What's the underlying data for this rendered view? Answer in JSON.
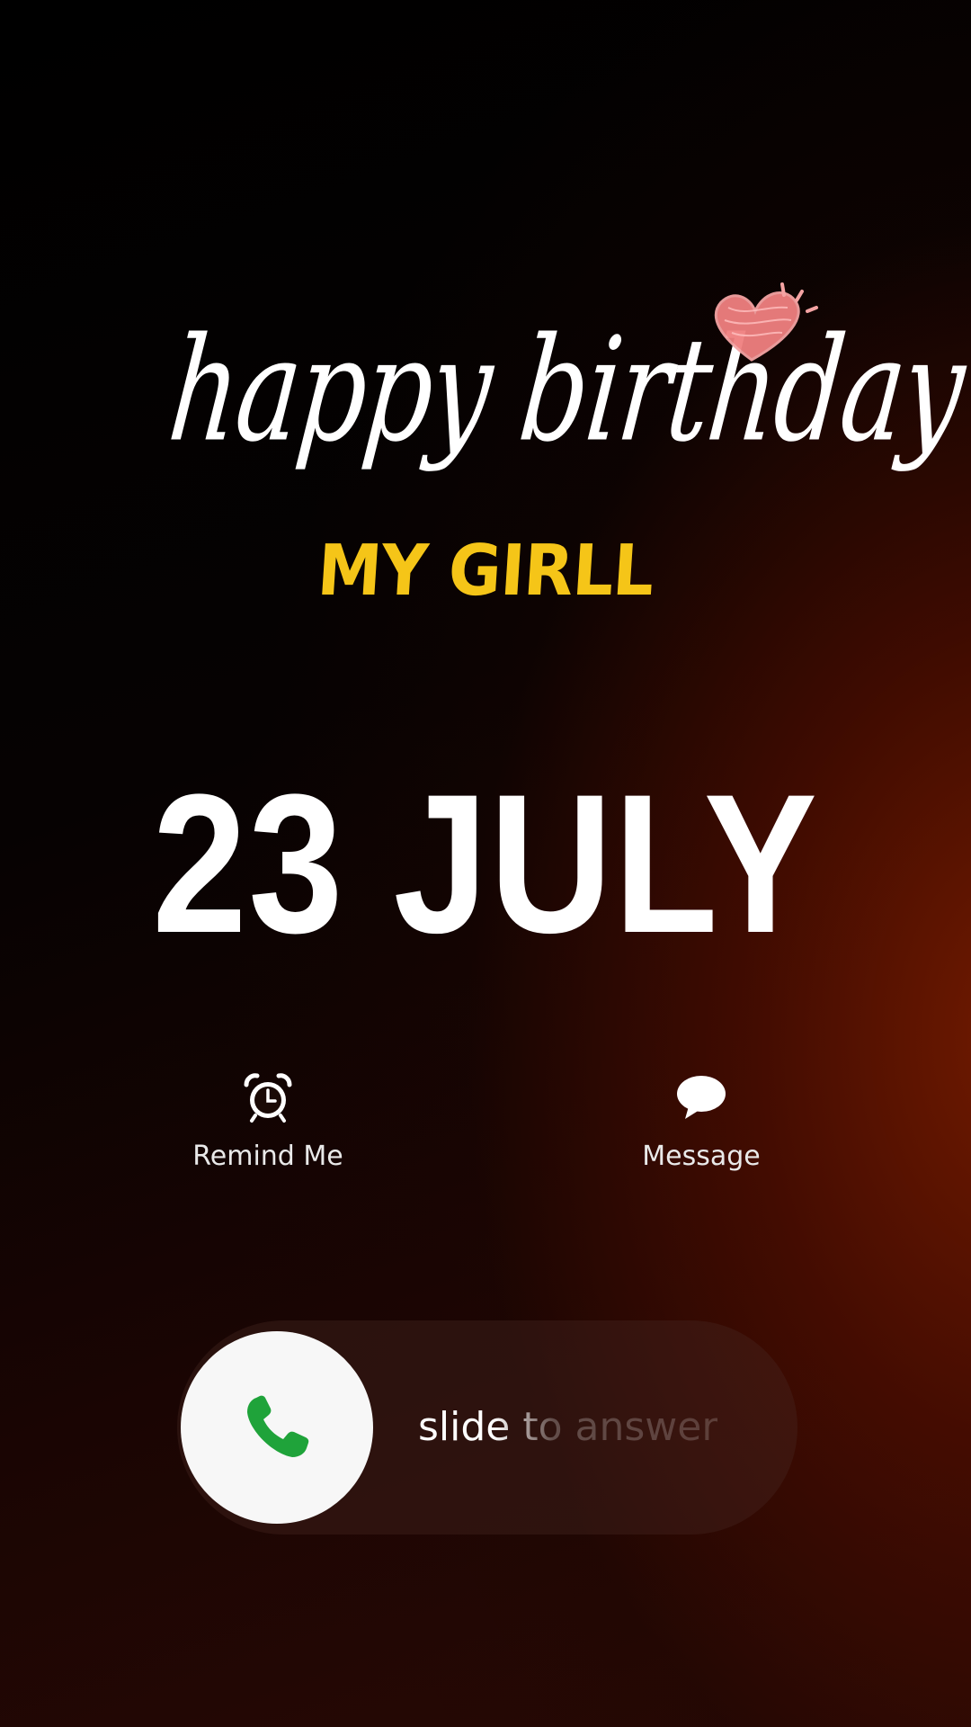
{
  "greeting": {
    "script_line": "happy birthday",
    "sub_line": "MY GIRLL"
  },
  "date_line": "23 JULY",
  "actions": [
    {
      "label": "Remind Me",
      "icon": "alarm-clock-icon"
    },
    {
      "label": "Message",
      "icon": "speech-bubble-icon"
    }
  ],
  "slider": {
    "label": "slide to answer",
    "icon": "phone-icon"
  },
  "colors": {
    "accent_yellow": "#f5c518",
    "phone_green": "#1fa33a",
    "heart_pink": "#f08080"
  }
}
